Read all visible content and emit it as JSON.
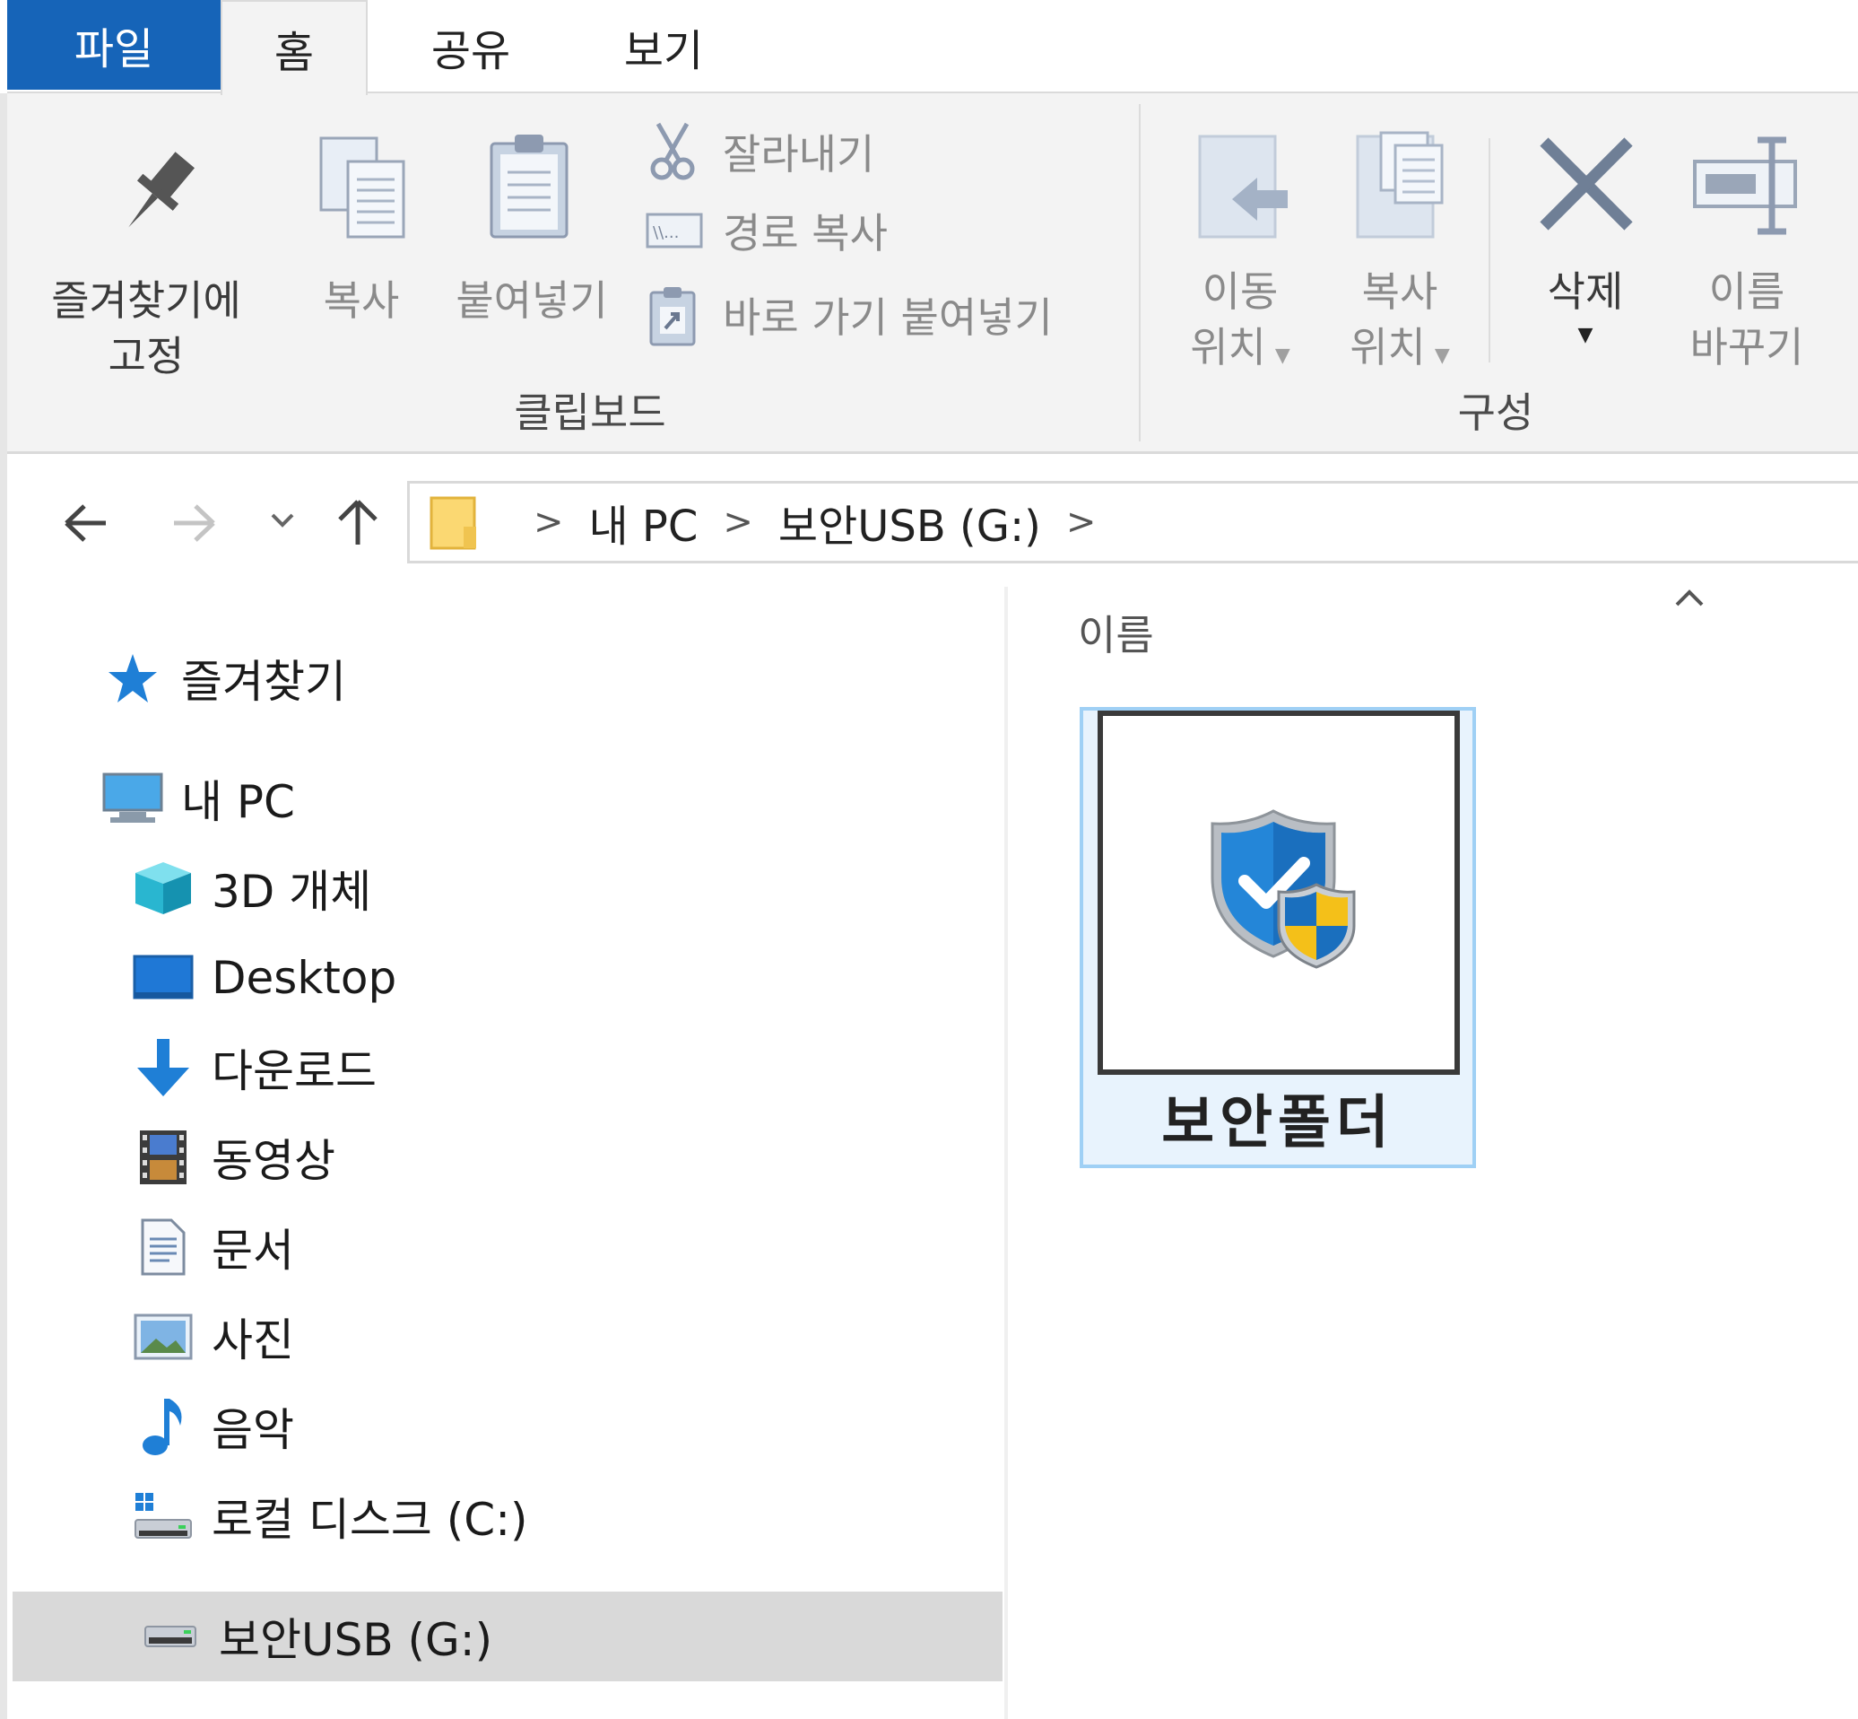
{
  "ribbon": {
    "tabs": {
      "file": "파일",
      "home": "홈",
      "share": "공유",
      "view": "보기"
    },
    "clipboard": {
      "pin_label_line1": "즐겨찾기에",
      "pin_label_line2": "고정",
      "copy_label": "복사",
      "paste_label": "붙여넣기",
      "cut_label": "잘라내기",
      "copy_path_label": "경로 복사",
      "paste_shortcut_label": "바로 가기 붙여넣기",
      "group_label": "클립보드"
    },
    "organize": {
      "move_to_line1": "이동",
      "move_to_line2": "위치",
      "copy_to_line1": "복사",
      "copy_to_line2": "위치",
      "delete_label": "삭제",
      "rename_line1": "이름",
      "rename_line2": "바꾸기",
      "group_label": "구성"
    }
  },
  "address": {
    "crumbs": [
      "내 PC",
      "보안USB (G:)"
    ],
    "separator": ">"
  },
  "nav": {
    "items": [
      {
        "label": "즐겨찾기",
        "icon": "star-icon"
      },
      {
        "label": "내 PC",
        "icon": "computer-icon"
      },
      {
        "label": "3D 개체",
        "icon": "3d-objects-icon"
      },
      {
        "label": "Desktop",
        "icon": "desktop-icon"
      },
      {
        "label": "다운로드",
        "icon": "download-icon"
      },
      {
        "label": "동영상",
        "icon": "video-icon"
      },
      {
        "label": "문서",
        "icon": "document-icon"
      },
      {
        "label": "사진",
        "icon": "picture-icon"
      },
      {
        "label": "음악",
        "icon": "music-icon"
      },
      {
        "label": "로컬 디스크 (C:)",
        "icon": "local-disk-icon"
      },
      {
        "label": "보안USB (G:)",
        "icon": "usb-drive-icon"
      }
    ]
  },
  "content": {
    "column_header": "이름",
    "items": [
      {
        "label": "보안폴더",
        "icon": "security-shield-icon"
      }
    ]
  },
  "colors": {
    "file_tab": "#1664b8",
    "selection_fill": "#e8f3fd",
    "selection_border": "#9fd0f5",
    "nav_selected": "#d9d9d9"
  }
}
